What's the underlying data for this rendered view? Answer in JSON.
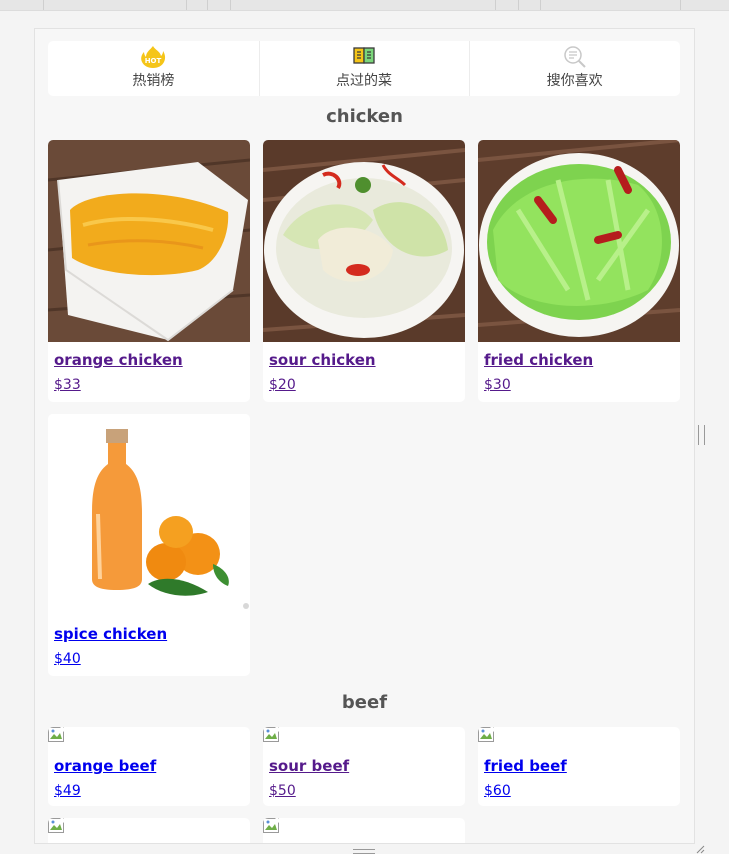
{
  "tabs": [
    {
      "label": "热销榜",
      "icon": "hot-fire-icon",
      "icon_text": "HOT"
    },
    {
      "label": "点过的菜",
      "icon": "open-book-icon"
    },
    {
      "label": "搜你喜欢",
      "icon": "search-magnifier-icon"
    }
  ],
  "sections": [
    {
      "title": "chicken",
      "items": [
        {
          "name": "orange chicken",
          "price": "$33"
        },
        {
          "name": "sour chicken",
          "price": "$20"
        },
        {
          "name": "fried chicken",
          "price": "$30"
        },
        {
          "name": "spice chicken",
          "price": "$40"
        }
      ]
    },
    {
      "title": "beef",
      "items": [
        {
          "name": "orange beef",
          "price": "$49"
        },
        {
          "name": "sour beef",
          "price": "$50"
        },
        {
          "name": "fried beef",
          "price": "$60"
        }
      ]
    }
  ],
  "colors": {
    "visited_link": "#551a8b",
    "unvisited_link": "#0000ee",
    "hot_icon": "#f5c518",
    "panel_bg": "#f7f7f7"
  }
}
